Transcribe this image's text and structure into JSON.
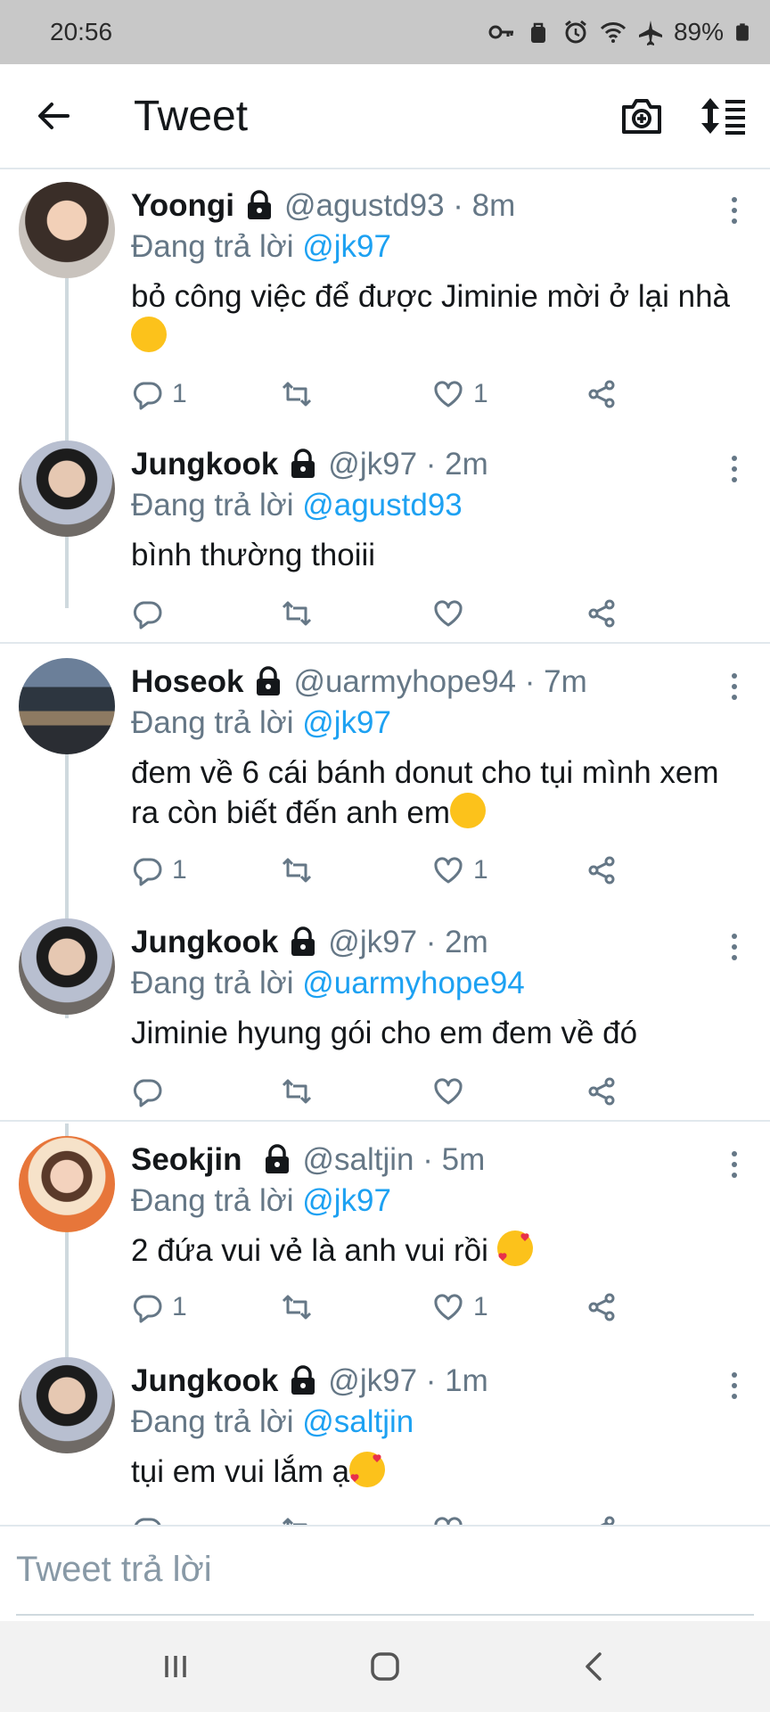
{
  "status_bar": {
    "time": "20:56",
    "battery": "89%",
    "icons": [
      "key-icon",
      "bag-icon",
      "alarm-icon",
      "wifi-icon",
      "airplane-icon",
      "battery-icon"
    ]
  },
  "header": {
    "title": "Tweet",
    "back_icon": "arrow-left-icon",
    "actions": [
      "camera-add-icon",
      "sort-icon"
    ]
  },
  "colors": {
    "accent": "#1da1f2",
    "muted": "#657786",
    "text": "#14171a",
    "divider": "#e1e8ed",
    "status_bar": "#c8c8c8"
  },
  "tweets": [
    {
      "name": "Yoongi",
      "handle": "@agustd93 · 8m",
      "reply_prefix": "Đang trả lời",
      "reply_mention": "@jk97",
      "text": "bỏ công việc để được Jiminie mời ở lại nhà",
      "emoji": "relieved-face-emoji",
      "reply_count": "1",
      "retweet_count": "",
      "like_count": "1"
    },
    {
      "name": "Jungkook",
      "handle": "@jk97 · 2m",
      "reply_prefix": "Đang trả lời",
      "reply_mention": "@agustd93",
      "text": "bình thường thoiii",
      "emoji": "",
      "reply_count": "",
      "retweet_count": "",
      "like_count": ""
    },
    {
      "name": "Hoseok",
      "handle": "@uarmyhope94 · 7m",
      "reply_prefix": "Đang trả lời",
      "reply_mention": "@jk97",
      "text": "đem về 6 cái bánh donut cho tụi mình xem ra còn biết đến anh em",
      "emoji": "relieved-face-emoji",
      "reply_count": "1",
      "retweet_count": "",
      "like_count": "1"
    },
    {
      "name": "Jungkook",
      "handle": "@jk97 · 2m",
      "reply_prefix": "Đang trả lời",
      "reply_mention": "@uarmyhope94",
      "text": "Jiminie hyung gói cho em đem về đó",
      "emoji": "",
      "reply_count": "",
      "retweet_count": "",
      "like_count": ""
    },
    {
      "name": "Seokjin",
      "handle": "@saltjin · 5m",
      "reply_prefix": "Đang trả lời",
      "reply_mention": "@jk97",
      "text": "2 đứa vui vẻ là anh vui rồi ",
      "emoji": "smiling-face-with-hearts-emoji",
      "reply_count": "1",
      "retweet_count": "",
      "like_count": "1"
    },
    {
      "name": "Jungkook",
      "handle": "@jk97 · 1m",
      "reply_prefix": "Đang trả lời",
      "reply_mention": "@saltjin",
      "text": "tụi em vui lắm ạ",
      "emoji": "smiling-face-with-hearts-emoji",
      "reply_count": "",
      "retweet_count": "",
      "like_count": ""
    }
  ],
  "reply_box": {
    "placeholder": "Tweet trả lời"
  },
  "nav_bar": {
    "icons": [
      "recent-apps-icon",
      "home-icon",
      "back-icon"
    ]
  }
}
